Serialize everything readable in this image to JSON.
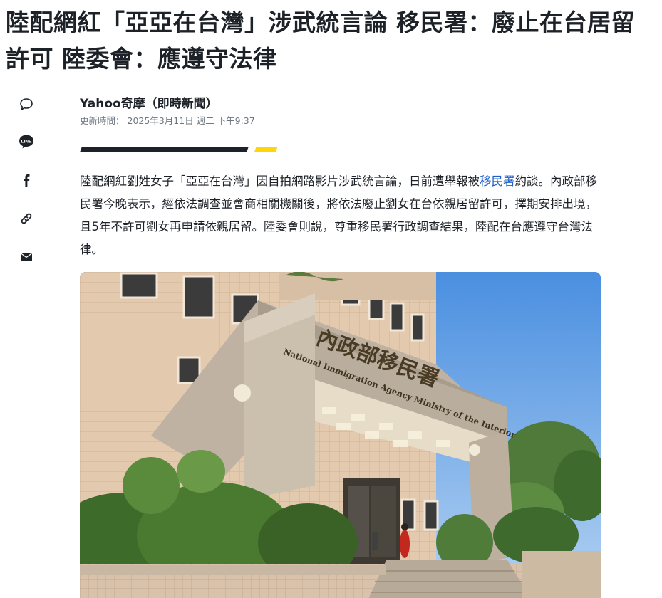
{
  "article": {
    "headline": "陸配網紅「亞亞在台灣」涉武統言論 移民署：廢止在台居留許可 陸委會：應遵守法律",
    "source": "Yahoo奇摩（即時新聞）",
    "updated_label": "更新時間：",
    "updated_value": "2025年3月11日 週二 下午9:37",
    "body_pre": "陸配網紅劉姓女子「亞亞在台灣」因自拍網路影片涉武統言論，日前遭舉報被",
    "body_link": "移民署",
    "body_post": "約談。內政部移民署今晚表示，經依法調查並會商相關機關後，將依法廢止劉女在台依親居留許可，擇期安排出境，且5年不許可劉女再申請依親居留。陸委會則說，尊重移民署行政調查結果，陸配在台應遵守台灣法律。"
  },
  "share": [
    {
      "name": "comment-icon",
      "label": "留言"
    },
    {
      "name": "line-icon",
      "label": "LINE"
    },
    {
      "name": "facebook-icon",
      "label": "f"
    },
    {
      "name": "link-icon",
      "label": "複製連結"
    },
    {
      "name": "mail-icon",
      "label": "電子郵件"
    }
  ],
  "photo": {
    "sign_chinese": "內政部移民署",
    "sign_english": "National Immigration Agency Ministry of the Interior"
  },
  "colors": {
    "text": "#1d2228",
    "muted": "#6e7780",
    "link": "#1f5fc6",
    "accent_yellow": "#ffd60a"
  }
}
